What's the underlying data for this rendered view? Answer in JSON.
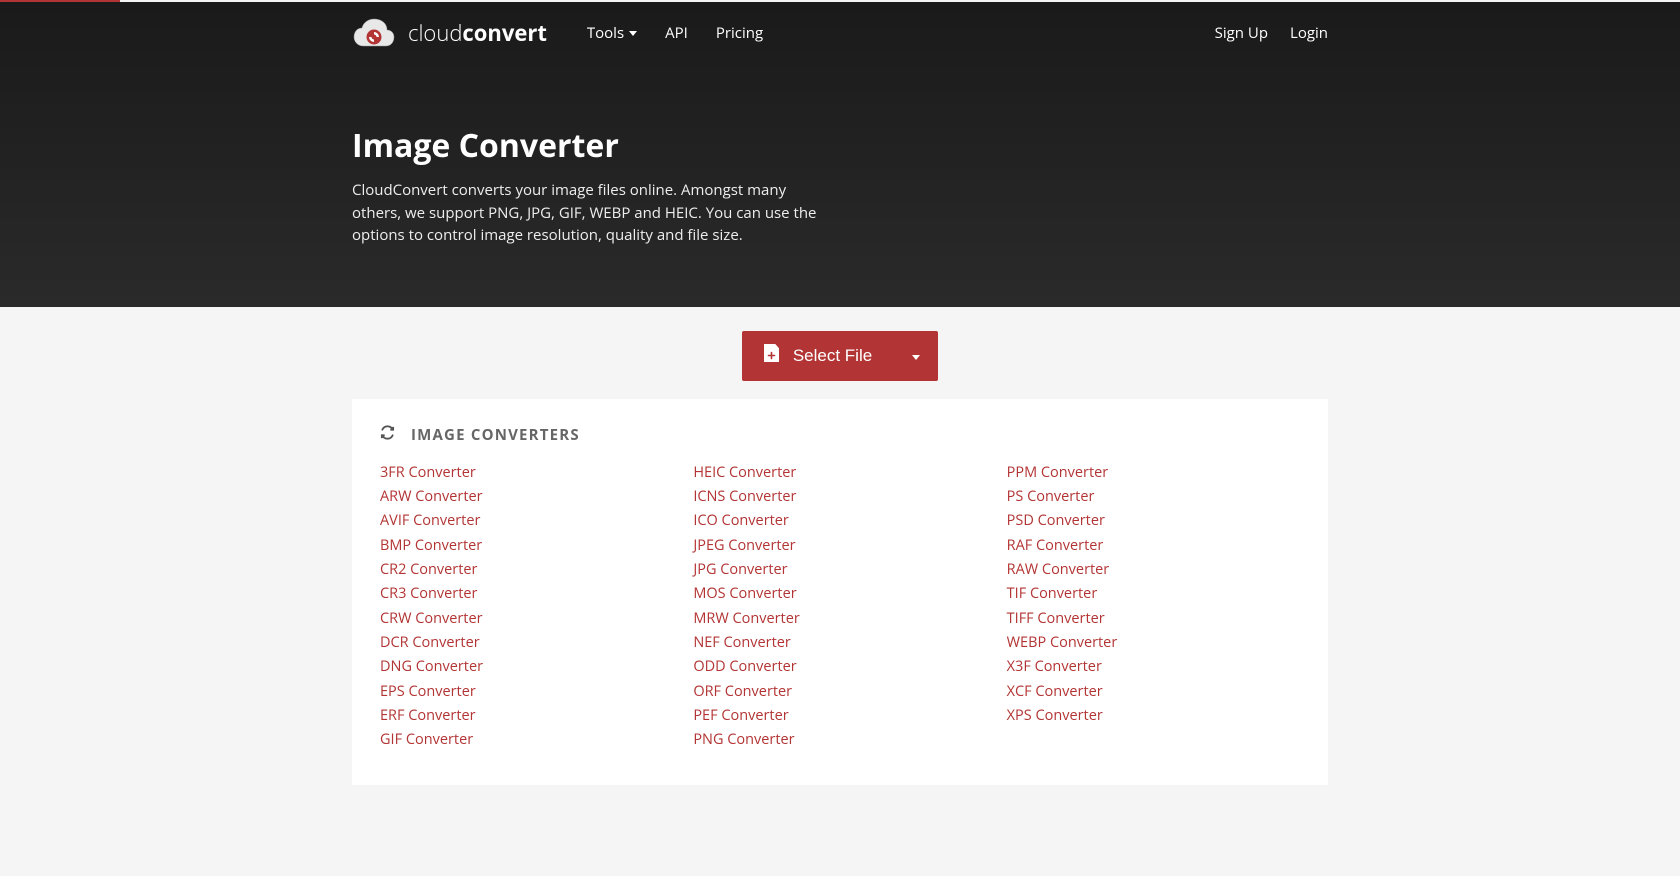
{
  "brand": {
    "part1": "cloud",
    "part2": "convert"
  },
  "nav": {
    "tools": "Tools",
    "api": "API",
    "pricing": "Pricing",
    "signup": "Sign Up",
    "login": "Login"
  },
  "hero": {
    "title": "Image Converter",
    "description": "CloudConvert converts your image files online. Amongst many others, we support PNG, JPG, GIF, WEBP and HEIC. You can use the options to control image resolution, quality and file size."
  },
  "select_file_label": "Select File",
  "converters_header": "IMAGE CONVERTERS",
  "converters": {
    "col1": [
      "3FR Converter",
      "ARW Converter",
      "AVIF Converter",
      "BMP Converter",
      "CR2 Converter",
      "CR3 Converter",
      "CRW Converter",
      "DCR Converter",
      "DNG Converter",
      "EPS Converter",
      "ERF Converter",
      "GIF Converter"
    ],
    "col2": [
      "HEIC Converter",
      "ICNS Converter",
      "ICO Converter",
      "JPEG Converter",
      "JPG Converter",
      "MOS Converter",
      "MRW Converter",
      "NEF Converter",
      "ODD Converter",
      "ORF Converter",
      "PEF Converter",
      "PNG Converter"
    ],
    "col3": [
      "PPM Converter",
      "PS Converter",
      "PSD Converter",
      "RAF Converter",
      "RAW Converter",
      "TIF Converter",
      "TIFF Converter",
      "WEBP Converter",
      "X3F Converter",
      "XCF Converter",
      "XPS Converter"
    ]
  }
}
